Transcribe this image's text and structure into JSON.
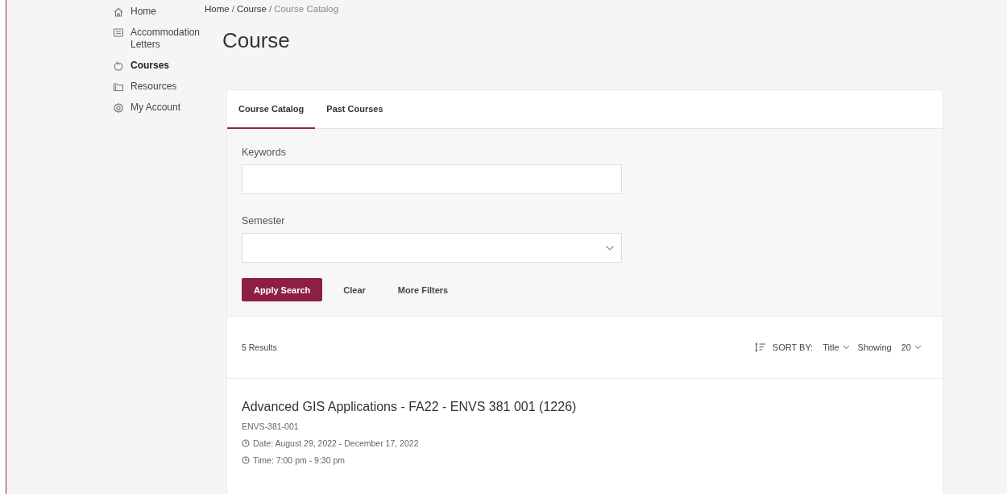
{
  "sidebar": {
    "items": [
      {
        "label": "Home",
        "selected": false
      },
      {
        "label": "Accommodation Letters",
        "selected": false
      },
      {
        "label": "Courses",
        "selected": true
      },
      {
        "label": "Resources",
        "selected": false
      },
      {
        "label": "My Account",
        "selected": false
      }
    ]
  },
  "breadcrumb": [
    {
      "kind": "crumb",
      "label": "Home",
      "current": false
    },
    {
      "kind": "separator",
      "label": "/"
    },
    {
      "kind": "crumb",
      "label": "Course",
      "current": false
    },
    {
      "kind": "separator",
      "label": "/"
    },
    {
      "kind": "crumb",
      "label": "Course Catalog",
      "current": true
    }
  ],
  "page_title": "Course",
  "tabs": [
    {
      "label": "Course Catalog",
      "selected": true
    },
    {
      "label": "Past Courses",
      "selected": false
    }
  ],
  "filters": [
    {
      "kind": "text",
      "label": "Keywords"
    },
    {
      "kind": "select",
      "label": "Semester"
    }
  ],
  "buttons": [
    {
      "kind": "primary",
      "label": "Apply Search"
    },
    {
      "kind": "link",
      "label": "Clear"
    },
    {
      "kind": "link",
      "label": "More Filters"
    }
  ],
  "results": {
    "count": "5 Results",
    "sort_label": "SORT BY:",
    "sort_value": "Title",
    "showing_label": "Showing",
    "showing_value": "20"
  },
  "courses": [
    {
      "title": "Advanced GIS Applications - FA22 - ENVS 381 001 (1226)",
      "code": "ENVS-381-001",
      "details": [
        "Date: August 29, 2022 - December 17, 2022",
        "Time: 7:00 pm - 9:30 pm"
      ]
    }
  ]
}
